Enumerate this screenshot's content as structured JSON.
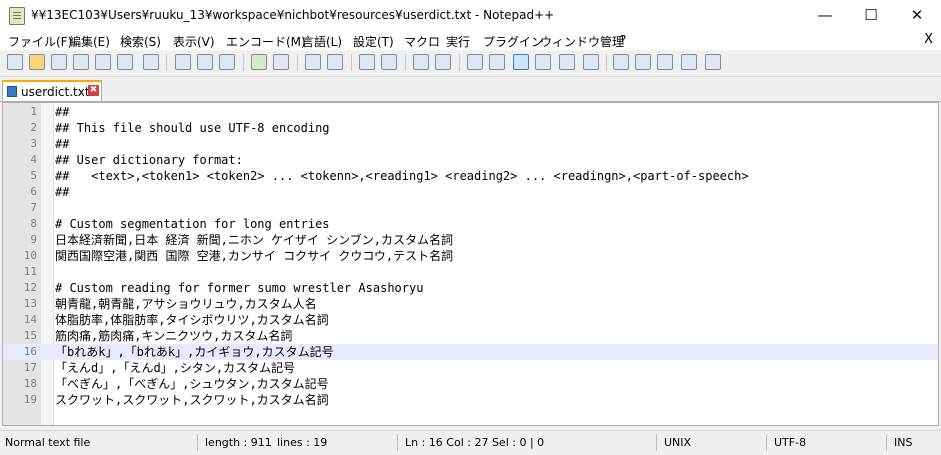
{
  "window": {
    "title": "¥¥13EC103¥Users¥ruuku_13¥workspace¥nichbot¥resources¥userdict.txt - Notepad++",
    "minimize": "—",
    "maximize": "☐",
    "close": "✕"
  },
  "menu": {
    "items": [
      "ファイル(F)",
      "編集(E)",
      "検索(S)",
      "表示(V)",
      "エンコード(M)",
      "言語(L)",
      "設定(T)",
      "マクロ",
      "実行",
      "プラグイン",
      "ウィンドウ管理",
      "?"
    ],
    "close": "X"
  },
  "tab": {
    "label": "userdict.txt",
    "close": "✖"
  },
  "editor": {
    "lines": [
      {
        "num": "1",
        "text": "##"
      },
      {
        "num": "2",
        "text": "## This file should use UTF-8 encoding"
      },
      {
        "num": "3",
        "text": "##"
      },
      {
        "num": "4",
        "text": "## User dictionary format:"
      },
      {
        "num": "5",
        "text": "##   <text>,<token1> <token2> ... <tokenn>,<reading1> <reading2> ... <readingn>,<part-of-speech>"
      },
      {
        "num": "6",
        "text": "##"
      },
      {
        "num": "7",
        "text": ""
      },
      {
        "num": "8",
        "text": "# Custom segmentation for long entries"
      },
      {
        "num": "9",
        "text": "日本経済新聞,日本 経済 新聞,ニホン ケイザイ シンブン,カスタム名詞"
      },
      {
        "num": "10",
        "text": "関西国際空港,関西 国際 空港,カンサイ コクサイ クウコウ,テスト名詞"
      },
      {
        "num": "11",
        "text": ""
      },
      {
        "num": "12",
        "text": "# Custom reading for former sumo wrestler Asashoryu"
      },
      {
        "num": "13",
        "text": "朝青龍,朝青龍,アサショウリュウ,カスタム人名"
      },
      {
        "num": "14",
        "text": "体脂肪率,体脂肪率,タイシボウリツ,カスタム名詞"
      },
      {
        "num": "15",
        "text": "筋肉痛,筋肉痛,キンニクツウ,カスタム名詞"
      },
      {
        "num": "16",
        "text": "「bれあk」,「bれあk」,カイギョウ,カスタム記号"
      },
      {
        "num": "17",
        "text": "「えんd」,「えんd」,シタン,カスタム記号"
      },
      {
        "num": "18",
        "text": "「べぎん」,「べぎん」,シュウタン,カスタム記号"
      },
      {
        "num": "19",
        "text": "スクワット,スクワット,スクワット,カスタム名詞"
      }
    ],
    "current_line": 16
  },
  "status": {
    "file_type": "Normal text file",
    "length": "length : 911",
    "lines": "lines : 19",
    "position": "Ln : 16    Col : 27    Sel : 0 | 0",
    "eol": "UNIX",
    "encoding": "UTF-8",
    "mode": "INS"
  },
  "colors": {
    "tab_accent": "#ffa600",
    "current_line": "#e8e8ff",
    "gutter": "#e4e4e4"
  }
}
